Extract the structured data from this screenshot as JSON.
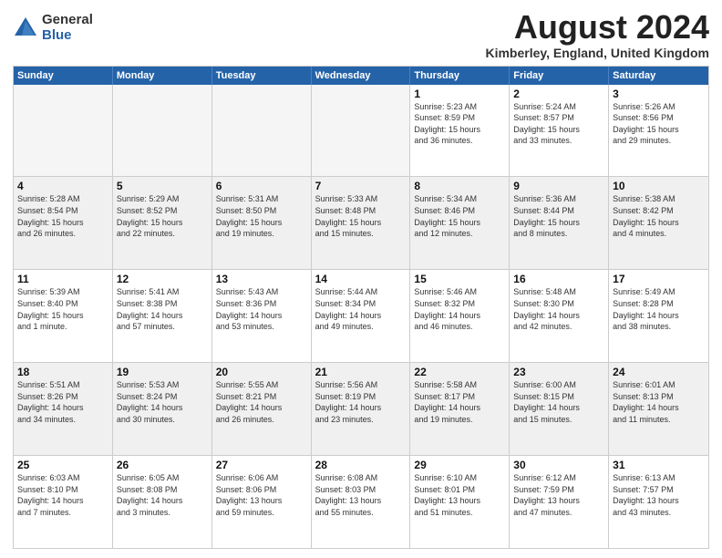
{
  "logo": {
    "general": "General",
    "blue": "Blue"
  },
  "title": "August 2024",
  "location": "Kimberley, England, United Kingdom",
  "days": [
    "Sunday",
    "Monday",
    "Tuesday",
    "Wednesday",
    "Thursday",
    "Friday",
    "Saturday"
  ],
  "weeks": [
    [
      {
        "day": "",
        "text": "",
        "empty": true
      },
      {
        "day": "",
        "text": "",
        "empty": true
      },
      {
        "day": "",
        "text": "",
        "empty": true
      },
      {
        "day": "",
        "text": "",
        "empty": true
      },
      {
        "day": "1",
        "text": "Sunrise: 5:23 AM\nSunset: 8:59 PM\nDaylight: 15 hours\nand 36 minutes."
      },
      {
        "day": "2",
        "text": "Sunrise: 5:24 AM\nSunset: 8:57 PM\nDaylight: 15 hours\nand 33 minutes."
      },
      {
        "day": "3",
        "text": "Sunrise: 5:26 AM\nSunset: 8:56 PM\nDaylight: 15 hours\nand 29 minutes."
      }
    ],
    [
      {
        "day": "4",
        "text": "Sunrise: 5:28 AM\nSunset: 8:54 PM\nDaylight: 15 hours\nand 26 minutes."
      },
      {
        "day": "5",
        "text": "Sunrise: 5:29 AM\nSunset: 8:52 PM\nDaylight: 15 hours\nand 22 minutes."
      },
      {
        "day": "6",
        "text": "Sunrise: 5:31 AM\nSunset: 8:50 PM\nDaylight: 15 hours\nand 19 minutes."
      },
      {
        "day": "7",
        "text": "Sunrise: 5:33 AM\nSunset: 8:48 PM\nDaylight: 15 hours\nand 15 minutes."
      },
      {
        "day": "8",
        "text": "Sunrise: 5:34 AM\nSunset: 8:46 PM\nDaylight: 15 hours\nand 12 minutes."
      },
      {
        "day": "9",
        "text": "Sunrise: 5:36 AM\nSunset: 8:44 PM\nDaylight: 15 hours\nand 8 minutes."
      },
      {
        "day": "10",
        "text": "Sunrise: 5:38 AM\nSunset: 8:42 PM\nDaylight: 15 hours\nand 4 minutes."
      }
    ],
    [
      {
        "day": "11",
        "text": "Sunrise: 5:39 AM\nSunset: 8:40 PM\nDaylight: 15 hours\nand 1 minute."
      },
      {
        "day": "12",
        "text": "Sunrise: 5:41 AM\nSunset: 8:38 PM\nDaylight: 14 hours\nand 57 minutes."
      },
      {
        "day": "13",
        "text": "Sunrise: 5:43 AM\nSunset: 8:36 PM\nDaylight: 14 hours\nand 53 minutes."
      },
      {
        "day": "14",
        "text": "Sunrise: 5:44 AM\nSunset: 8:34 PM\nDaylight: 14 hours\nand 49 minutes."
      },
      {
        "day": "15",
        "text": "Sunrise: 5:46 AM\nSunset: 8:32 PM\nDaylight: 14 hours\nand 46 minutes."
      },
      {
        "day": "16",
        "text": "Sunrise: 5:48 AM\nSunset: 8:30 PM\nDaylight: 14 hours\nand 42 minutes."
      },
      {
        "day": "17",
        "text": "Sunrise: 5:49 AM\nSunset: 8:28 PM\nDaylight: 14 hours\nand 38 minutes."
      }
    ],
    [
      {
        "day": "18",
        "text": "Sunrise: 5:51 AM\nSunset: 8:26 PM\nDaylight: 14 hours\nand 34 minutes."
      },
      {
        "day": "19",
        "text": "Sunrise: 5:53 AM\nSunset: 8:24 PM\nDaylight: 14 hours\nand 30 minutes."
      },
      {
        "day": "20",
        "text": "Sunrise: 5:55 AM\nSunset: 8:21 PM\nDaylight: 14 hours\nand 26 minutes."
      },
      {
        "day": "21",
        "text": "Sunrise: 5:56 AM\nSunset: 8:19 PM\nDaylight: 14 hours\nand 23 minutes."
      },
      {
        "day": "22",
        "text": "Sunrise: 5:58 AM\nSunset: 8:17 PM\nDaylight: 14 hours\nand 19 minutes."
      },
      {
        "day": "23",
        "text": "Sunrise: 6:00 AM\nSunset: 8:15 PM\nDaylight: 14 hours\nand 15 minutes."
      },
      {
        "day": "24",
        "text": "Sunrise: 6:01 AM\nSunset: 8:13 PM\nDaylight: 14 hours\nand 11 minutes."
      }
    ],
    [
      {
        "day": "25",
        "text": "Sunrise: 6:03 AM\nSunset: 8:10 PM\nDaylight: 14 hours\nand 7 minutes."
      },
      {
        "day": "26",
        "text": "Sunrise: 6:05 AM\nSunset: 8:08 PM\nDaylight: 14 hours\nand 3 minutes."
      },
      {
        "day": "27",
        "text": "Sunrise: 6:06 AM\nSunset: 8:06 PM\nDaylight: 13 hours\nand 59 minutes."
      },
      {
        "day": "28",
        "text": "Sunrise: 6:08 AM\nSunset: 8:03 PM\nDaylight: 13 hours\nand 55 minutes."
      },
      {
        "day": "29",
        "text": "Sunrise: 6:10 AM\nSunset: 8:01 PM\nDaylight: 13 hours\nand 51 minutes."
      },
      {
        "day": "30",
        "text": "Sunrise: 6:12 AM\nSunset: 7:59 PM\nDaylight: 13 hours\nand 47 minutes."
      },
      {
        "day": "31",
        "text": "Sunrise: 6:13 AM\nSunset: 7:57 PM\nDaylight: 13 hours\nand 43 minutes."
      }
    ]
  ]
}
